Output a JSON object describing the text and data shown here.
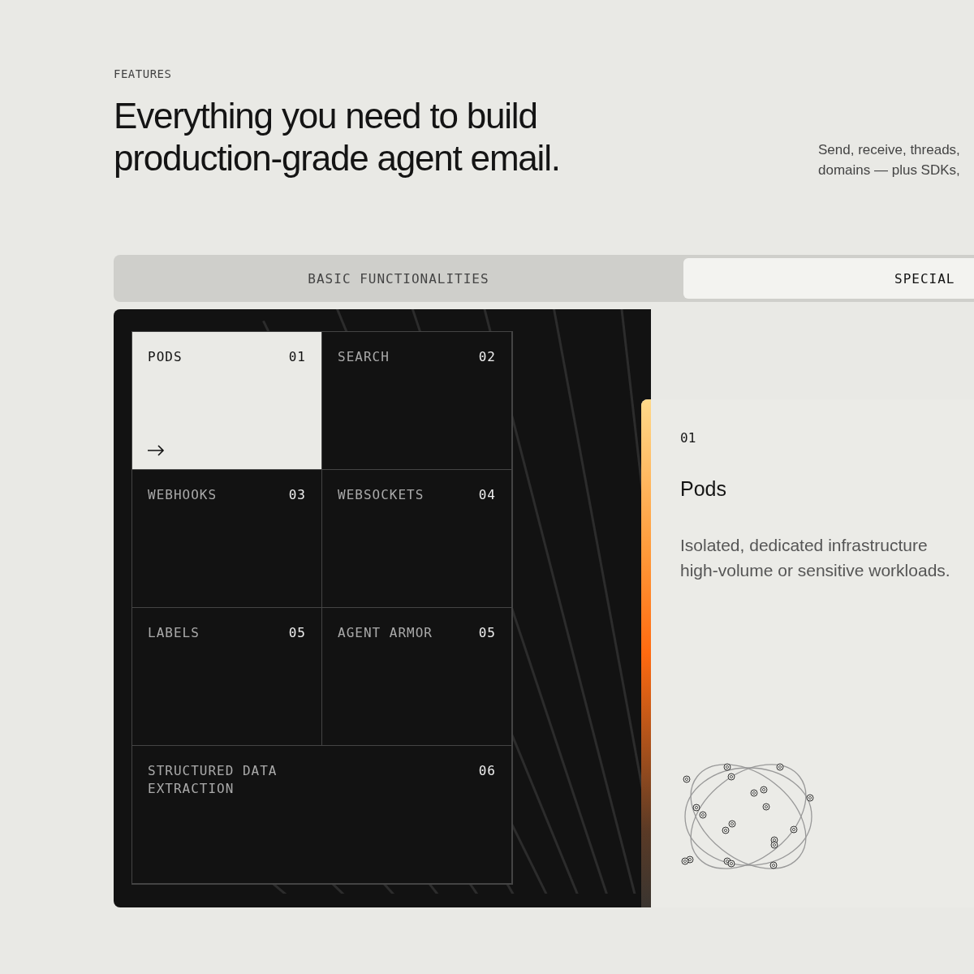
{
  "eyebrow": "FEATURES",
  "heading": [
    "Everything you need to build",
    "production-grade agent email."
  ],
  "intro": [
    "Send, receive, threads,",
    "domains — plus SDKs,"
  ],
  "tabs": [
    {
      "label": "BASIC FUNCTIONALITIES",
      "selected": false
    },
    {
      "label": "SPECIAL",
      "selected": true
    }
  ],
  "features": [
    {
      "label": "PODS",
      "number": "01",
      "selected": true
    },
    {
      "label": "SEARCH",
      "number": "02",
      "selected": false
    },
    {
      "label": "WEBHOOKS",
      "number": "03",
      "selected": false
    },
    {
      "label": "WEBSOCKETS",
      "number": "04",
      "selected": false
    },
    {
      "label": "LABELS",
      "number": "05",
      "selected": false
    },
    {
      "label": "AGENT ARMOR",
      "number": "05",
      "selected": false
    },
    {
      "label": "STRUCTURED DATA EXTRACTION",
      "number": "06",
      "selected": false
    }
  ],
  "detail": {
    "number": "01",
    "title": "Pods",
    "lines": [
      "Isolated, dedicated infrastructure",
      "high-volume or sensitive workloads."
    ]
  }
}
